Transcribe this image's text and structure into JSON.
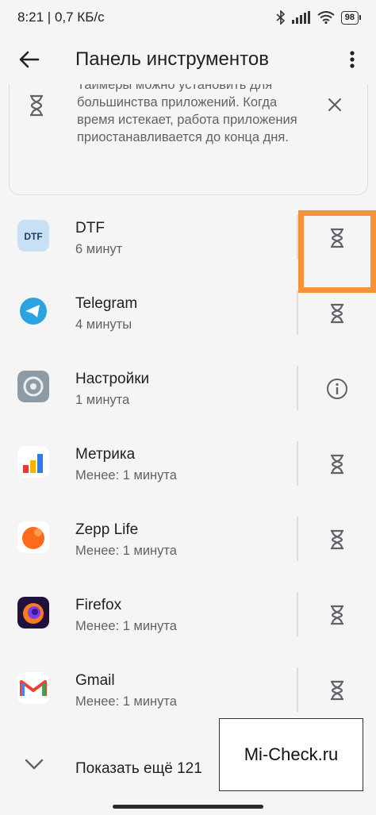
{
  "status_bar": {
    "time_speed": "8:21 | 0,7 КБ/с",
    "battery": "98"
  },
  "app_bar": {
    "title": "Панель инструментов",
    "back_icon": "arrow-back-icon",
    "more_icon": "more-vert-icon"
  },
  "info_card": {
    "text": "Таймеры можно установить для большинства приложений. Когда время истекает, работа приложения приостанавливается до конца дня.",
    "icon": "hourglass-icon",
    "close_icon": "close-icon"
  },
  "apps": [
    {
      "name": "DTF",
      "usage": "6 минут",
      "action_icon": "hourglass-icon",
      "logo": "dtf-logo"
    },
    {
      "name": "Telegram",
      "usage": "4 минуты",
      "action_icon": "hourglass-icon",
      "logo": "telegram-logo"
    },
    {
      "name": "Настройки",
      "usage": "1 минута",
      "action_icon": "info-icon",
      "logo": "settings-logo"
    },
    {
      "name": "Метрика",
      "usage": "Менее: 1 минута",
      "action_icon": "hourglass-icon",
      "logo": "metrika-logo"
    },
    {
      "name": "Zepp Life",
      "usage": "Менее: 1 минута",
      "action_icon": "hourglass-icon",
      "logo": "zepp-logo"
    },
    {
      "name": "Firefox",
      "usage": "Менее: 1 минута",
      "action_icon": "hourglass-icon",
      "logo": "firefox-logo"
    },
    {
      "name": "Gmail",
      "usage": "Менее: 1 минута",
      "action_icon": "hourglass-icon",
      "logo": "gmail-logo"
    }
  ],
  "show_more": {
    "label": "Показать ещё 121",
    "icon": "chevron-down-icon"
  },
  "watermark": "Mi-Check.ru",
  "colors": {
    "highlight": "#f5923a",
    "background": "#f5f5f5",
    "secondary_text": "#5f6368"
  }
}
